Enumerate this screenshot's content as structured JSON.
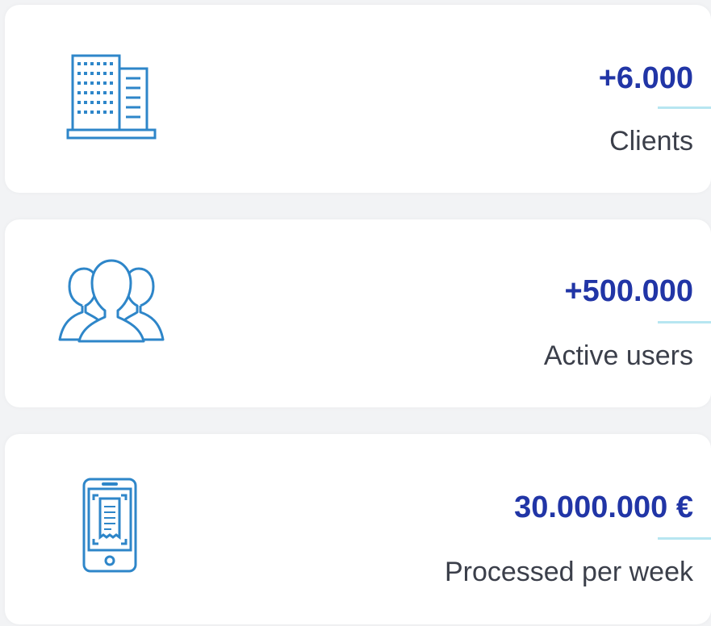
{
  "colors": {
    "accent": "#2135a6",
    "icon": "#2e86c9",
    "divider": "#b7e6f1",
    "label": "#3b3f4a",
    "card": "#ffffff",
    "background": "#f2f3f5"
  },
  "stats": [
    {
      "icon": "building-icon",
      "value": "+6.000",
      "label": "Clients"
    },
    {
      "icon": "users-icon",
      "value": "+500.000",
      "label": "Active users"
    },
    {
      "icon": "phone-receipt-icon",
      "value": "30.000.000 €",
      "label": "Processed per week"
    }
  ]
}
